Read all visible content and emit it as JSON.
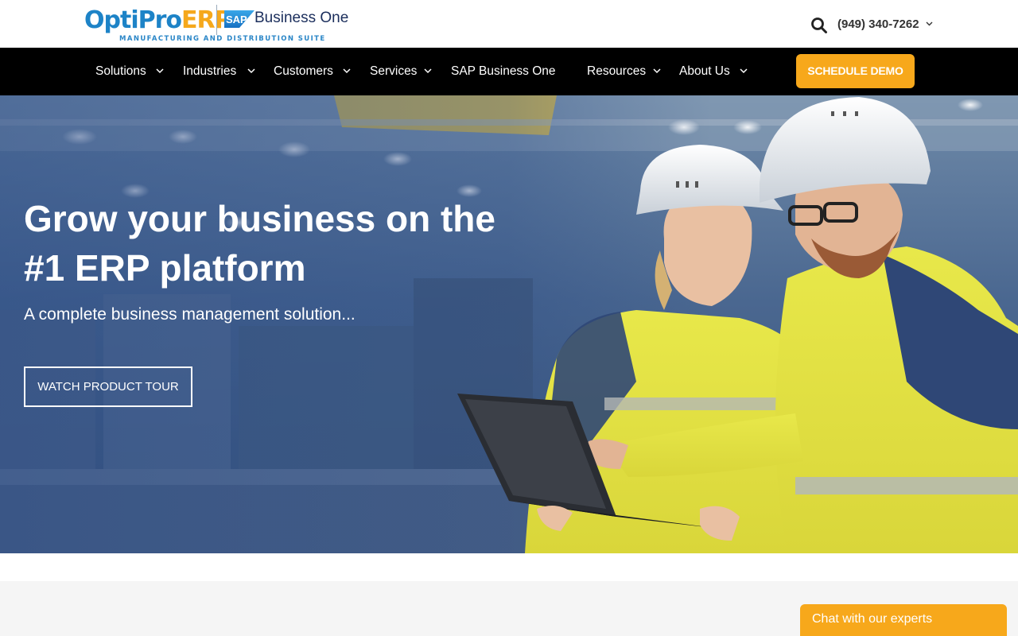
{
  "header": {
    "logo": {
      "brand_part1": "OptiPro",
      "brand_part2": "ERP",
      "registered": "®",
      "tagline": "MANUFACTURING AND DISTRIBUTION SUITE",
      "partner_logo": "SAP",
      "partner_product": "Business One"
    },
    "search_icon": "search-icon",
    "phone": "(949) 340-7262"
  },
  "nav": {
    "items": [
      {
        "label": "Solutions",
        "has_dropdown": true
      },
      {
        "label": "Industries",
        "has_dropdown": true
      },
      {
        "label": "Customers",
        "has_dropdown": true
      },
      {
        "label": "Services",
        "has_dropdown": true
      },
      {
        "label": "SAP Business One",
        "has_dropdown": false
      },
      {
        "label": "Resources",
        "has_dropdown": true
      },
      {
        "label": "About Us",
        "has_dropdown": true
      }
    ],
    "cta": "SCHEDULE DEMO"
  },
  "hero": {
    "title": "Grow your business on the #1 ERP platform",
    "subtitle": "A complete business management solution...",
    "button": "WATCH PRODUCT TOUR"
  },
  "chat": {
    "label": "Chat with our experts"
  },
  "colors": {
    "brand_blue": "#1d83c7",
    "brand_orange": "#f5a81c",
    "cta_orange": "#f7a81b",
    "nav_bg": "#000000",
    "sap_blue": "#1b2e5c"
  }
}
